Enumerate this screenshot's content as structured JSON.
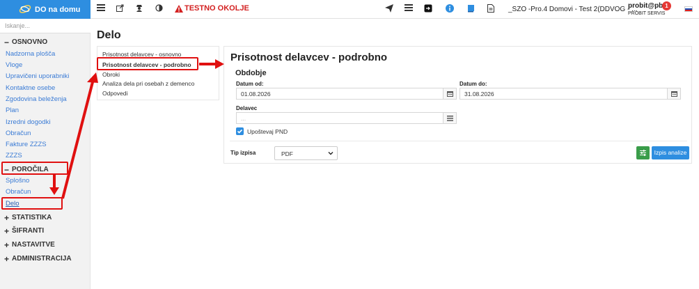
{
  "app": {
    "brand": "DO na domu",
    "warning": "TESTNO OKOLJE",
    "context": "_SZO -Pro.4 Domovi - Test 2(DDVOG - ...",
    "user": "probit@pb5",
    "org": "PROBIT SERVIS",
    "notifications": "1"
  },
  "sidebar": {
    "search_placeholder": "Iskanje...",
    "sections": {
      "osnovno": "OSNOVNO",
      "porocila": "POROČILA",
      "statistika": "STATISTIKA",
      "sifranti": "ŠIFRANTI",
      "nastavitve": "NASTAVITVE",
      "administracija": "ADMINISTRACIJA"
    },
    "osnovno_items": [
      "Nadzorna plošča",
      "Vloge",
      "Upravičeni uporabniki",
      "Kontaktne osebe",
      "Zgodovina beleženja",
      "Plan",
      "Izredni dogodki",
      "Obračun",
      "Fakture ZZZS",
      "ZZZS"
    ],
    "porocila_items": [
      "Splošno",
      "Obračun",
      "Delo"
    ]
  },
  "main": {
    "title": "Delo",
    "subnav": [
      "Prisotnost delavcev - osnovno",
      "Prisotnost delavcev - podrobno",
      "Obroki",
      "Analiza dela pri osebah z demenco",
      "Odpovedi"
    ]
  },
  "panel": {
    "title": "Prisotnost delavcev - podrobno",
    "section": "Obdobje",
    "date_from_label": "Datum od:",
    "date_from": "01.08.2026",
    "date_to_label": "Datum do:",
    "date_to": "31.08.2026",
    "worker_label": "Delavec",
    "worker_placeholder": "...",
    "pnd_label": "Upoštevaj PND",
    "pnd_checked": true,
    "type_label": "Tip izpisa",
    "type_value": "PDF",
    "analyze_button": "Izpis analize"
  }
}
